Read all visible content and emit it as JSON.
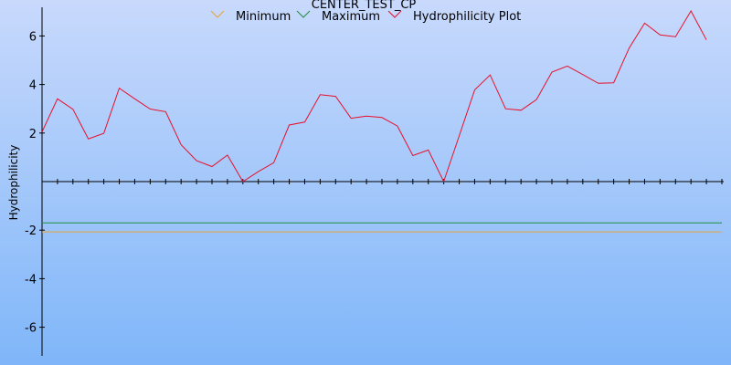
{
  "chart_data": {
    "type": "line",
    "title": "CENTER_TEST_CP",
    "ylabel": "Hydrophilicity",
    "xlabel": "",
    "ylim": [
      -7.2,
      7.1
    ],
    "yticks": [
      -6,
      -4,
      -2,
      2,
      4,
      6
    ],
    "grid": false,
    "legend_position": "top",
    "x": [
      1,
      2,
      3,
      4,
      5,
      6,
      7,
      8,
      9,
      10,
      11,
      12,
      13,
      14,
      15,
      16,
      17,
      18,
      19,
      20,
      21,
      22,
      23,
      24,
      25,
      26,
      27,
      28,
      29,
      30,
      31,
      32,
      33,
      34,
      35,
      36,
      37,
      38,
      39,
      40,
      41,
      42,
      43,
      44,
      45
    ],
    "series": [
      {
        "name": "Minimum",
        "color": "#e8a33c",
        "values": [
          -2.07,
          -2.07,
          -2.07,
          -2.07,
          -2.07,
          -2.07,
          -2.07,
          -2.07,
          -2.07,
          -2.07,
          -2.07,
          -2.07,
          -2.07,
          -2.07,
          -2.07,
          -2.07,
          -2.07,
          -2.07,
          -2.07,
          -2.07,
          -2.07,
          -2.07,
          -2.07,
          -2.07,
          -2.07,
          -2.07,
          -2.07,
          -2.07,
          -2.07,
          -2.07,
          -2.07,
          -2.07,
          -2.07,
          -2.07,
          -2.07,
          -2.07,
          -2.07,
          -2.07,
          -2.07,
          -2.07,
          -2.07,
          -2.07,
          -2.07,
          -2.07,
          -2.07
        ]
      },
      {
        "name": "Maximum",
        "color": "#1f8f3a",
        "values": [
          -1.7,
          -1.7,
          -1.7,
          -1.7,
          -1.7,
          -1.7,
          -1.7,
          -1.7,
          -1.7,
          -1.7,
          -1.7,
          -1.7,
          -1.7,
          -1.7,
          -1.7,
          -1.7,
          -1.7,
          -1.7,
          -1.7,
          -1.7,
          -1.7,
          -1.7,
          -1.7,
          -1.7,
          -1.7,
          -1.7,
          -1.7,
          -1.7,
          -1.7,
          -1.7,
          -1.7,
          -1.7,
          -1.7,
          -1.7,
          -1.7,
          -1.7,
          -1.7,
          -1.7,
          -1.7,
          -1.7,
          -1.7,
          -1.7,
          -1.7,
          -1.7,
          -1.7
        ]
      },
      {
        "name": "Hydrophilicity Plot",
        "color": "#e8102a",
        "values": [
          2.05,
          3.41,
          2.98,
          1.76,
          1.99,
          3.85,
          3.41,
          2.99,
          2.88,
          1.52,
          0.86,
          0.62,
          1.09,
          0.0,
          0.41,
          0.78,
          2.33,
          2.45,
          3.58,
          3.51,
          2.61,
          2.7,
          2.64,
          2.29,
          1.07,
          1.3,
          0.0,
          1.88,
          3.78,
          4.39,
          3.0,
          2.94,
          3.38,
          4.51,
          4.76,
          4.41,
          4.05,
          4.07,
          5.5,
          6.53,
          6.04,
          5.97,
          7.03,
          5.84
        ]
      }
    ]
  }
}
